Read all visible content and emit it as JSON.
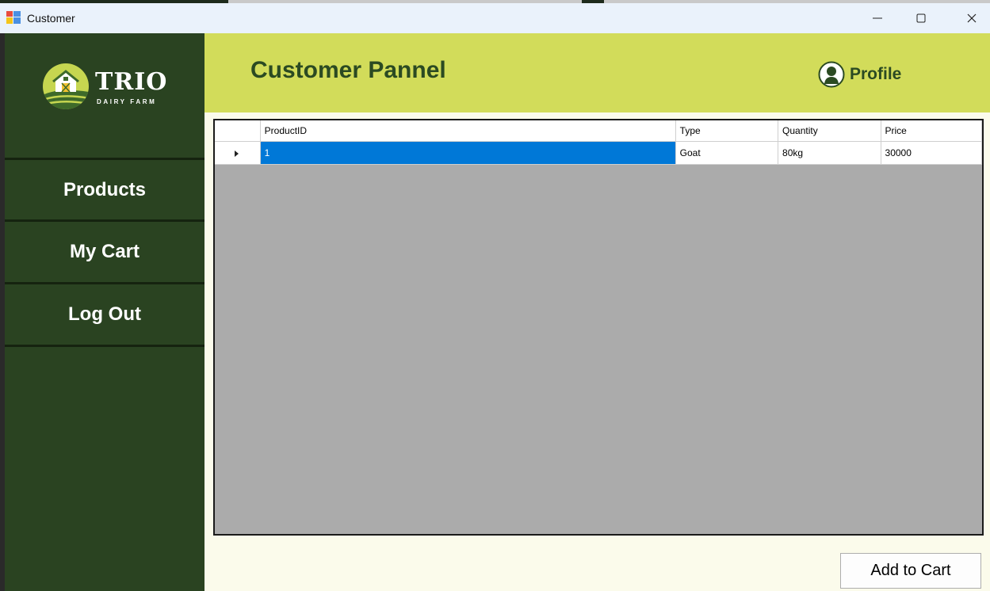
{
  "window": {
    "title": "Customer"
  },
  "sidebar": {
    "logo": {
      "word": "TRIO",
      "subtitle": "DAIRY FARM"
    },
    "items": [
      {
        "label": "Products"
      },
      {
        "label": "My Cart"
      },
      {
        "label": "Log Out"
      }
    ]
  },
  "header": {
    "title": "Customer Pannel",
    "profile_label": "Profile"
  },
  "grid": {
    "columns": [
      "ProductID",
      "Type",
      "Quantity",
      "Price"
    ],
    "rows": [
      {
        "ProductID": "1",
        "Type": "Goat",
        "Quantity": "80kg",
        "Price": "30000",
        "selected_cell": "ProductID"
      }
    ]
  },
  "actions": {
    "add_to_cart_label": "Add to Cart"
  },
  "colors": {
    "sidebar_bg": "#2a4321",
    "header_bg": "#d2dc5a",
    "header_text": "#2b4a22",
    "content_bg": "#fbfbeb",
    "grid_empty_bg": "#ababab",
    "selection": "#0078d7"
  }
}
